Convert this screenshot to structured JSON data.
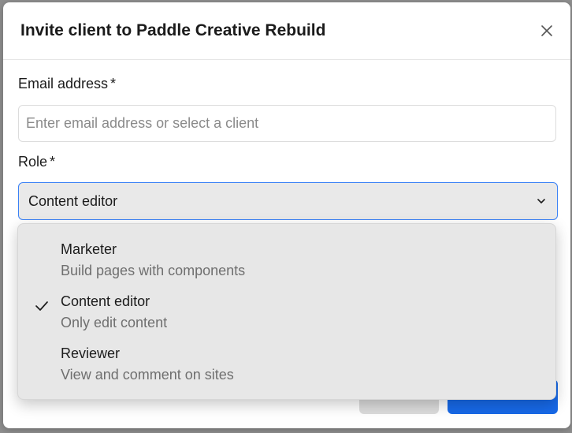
{
  "modal": {
    "title": "Invite client to Paddle Creative Rebuild"
  },
  "email_field": {
    "label": "Email address",
    "required_mark": "*",
    "placeholder": "Enter email address or select a client",
    "value": ""
  },
  "role_field": {
    "label": "Role",
    "required_mark": "*",
    "selected": "Content editor"
  },
  "role_options": [
    {
      "title": "Marketer",
      "description": "Build pages with components",
      "selected": false
    },
    {
      "title": "Content editor",
      "description": "Only edit content",
      "selected": true
    },
    {
      "title": "Reviewer",
      "description": "View and comment on sites",
      "selected": false
    }
  ],
  "icons": {
    "close": "close-icon",
    "chevron": "chevron-down-icon",
    "check": "check-icon"
  },
  "colors": {
    "primary": "#1769e8",
    "focus_border": "#3b82f6",
    "dropdown_bg": "#e7e7e7"
  }
}
